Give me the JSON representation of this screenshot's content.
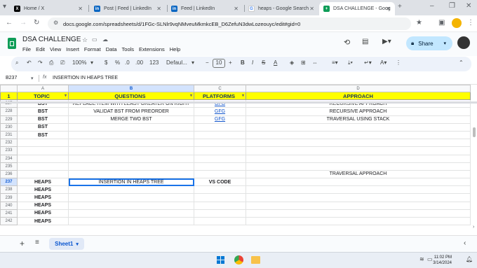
{
  "browser": {
    "tabs": [
      {
        "title": "Home / X",
        "icon": "x-logo-icon",
        "color": "#000000"
      },
      {
        "title": "Post | Feed | LinkedIn",
        "icon": "linkedin-icon",
        "color": "#0a66c2"
      },
      {
        "title": "Feed | LinkedIn",
        "icon": "linkedin-icon",
        "color": "#0a66c2"
      },
      {
        "title": "heaps - Google Search",
        "icon": "google-icon",
        "color": "#4285f4"
      },
      {
        "title": "DSA CHALLENGE - Goog",
        "icon": "sheets-icon",
        "color": "#0f9d58"
      }
    ],
    "url": "docs.google.com/spreadsheets/d/1FGc-SLNlr9vqNMveuMkmkcEB_D6ZefuN3dwLozeouyc/edit#gid=0"
  },
  "sheets": {
    "title": "DSA CHALLENGE",
    "menu": [
      "File",
      "Edit",
      "View",
      "Insert",
      "Format",
      "Data",
      "Tools",
      "Extensions",
      "Help"
    ],
    "share_label": "Share",
    "zoom": "100%",
    "currency": "$",
    "percent": "%",
    "decimals_less": ".0",
    "decimals_more": ".00",
    "number_format": "123",
    "font": "Defaul...",
    "font_size": "10",
    "cell_ref": "B237",
    "formula": "INSERTION IN HEAPS TREE"
  },
  "grid": {
    "columns": [
      "",
      "A",
      "B",
      "C",
      "D"
    ],
    "header": {
      "row": "1",
      "cells": [
        "TOPIC",
        "QUESTIONS",
        "PLATFORMS",
        "APPROACH"
      ]
    },
    "rows": [
      {
        "n": "227",
        "a": "BST",
        "b": "REPLACE ITEM WITH LEAST GREATER ON RIGHT",
        "c": "GFG",
        "d": "RECURSIVE APPROACH"
      },
      {
        "n": "228",
        "a": "BST",
        "b": "VALIDAT BST FROM PREORDER",
        "c": "GFG",
        "d": "RECURSIVE APPROACH"
      },
      {
        "n": "229",
        "a": "BST",
        "b": "MERGE TWO BST",
        "c": "GFG",
        "d": "TRAVERSAL USING STACK"
      },
      {
        "n": "230",
        "a": "BST",
        "b": "",
        "c": "",
        "d": ""
      },
      {
        "n": "231",
        "a": "BST",
        "b": "",
        "c": "",
        "d": ""
      },
      {
        "n": "232",
        "a": "",
        "b": "",
        "c": "",
        "d": ""
      },
      {
        "n": "233",
        "a": "",
        "b": "",
        "c": "",
        "d": ""
      },
      {
        "n": "234",
        "a": "",
        "b": "",
        "c": "",
        "d": ""
      },
      {
        "n": "235",
        "a": "",
        "b": "",
        "c": "",
        "d": ""
      },
      {
        "n": "236",
        "a": "",
        "b": "",
        "c": "",
        "d": "TRAVERSAL APPROACH"
      },
      {
        "n": "237",
        "a": "HEAPS",
        "b": "INSERTION IN HEAPS TREE",
        "c": "VS CODE",
        "d": ""
      },
      {
        "n": "238",
        "a": "HEAPS",
        "b": "",
        "c": "",
        "d": ""
      },
      {
        "n": "239",
        "a": "HEAPS",
        "b": "",
        "c": "",
        "d": ""
      },
      {
        "n": "240",
        "a": "HEAPS",
        "b": "",
        "c": "",
        "d": ""
      },
      {
        "n": "241",
        "a": "HEAPS",
        "b": "",
        "c": "",
        "d": ""
      },
      {
        "n": "242",
        "a": "HEAPS",
        "b": "",
        "c": "",
        "d": ""
      }
    ]
  },
  "sheet_tabs": {
    "active": "Sheet1"
  },
  "taskbar": {
    "time": "11:02 PM",
    "date": "3/14/2024"
  },
  "colors": {
    "header_yellow": "#ffff00",
    "link": "#1155cc",
    "selection": "#1a73e8"
  }
}
